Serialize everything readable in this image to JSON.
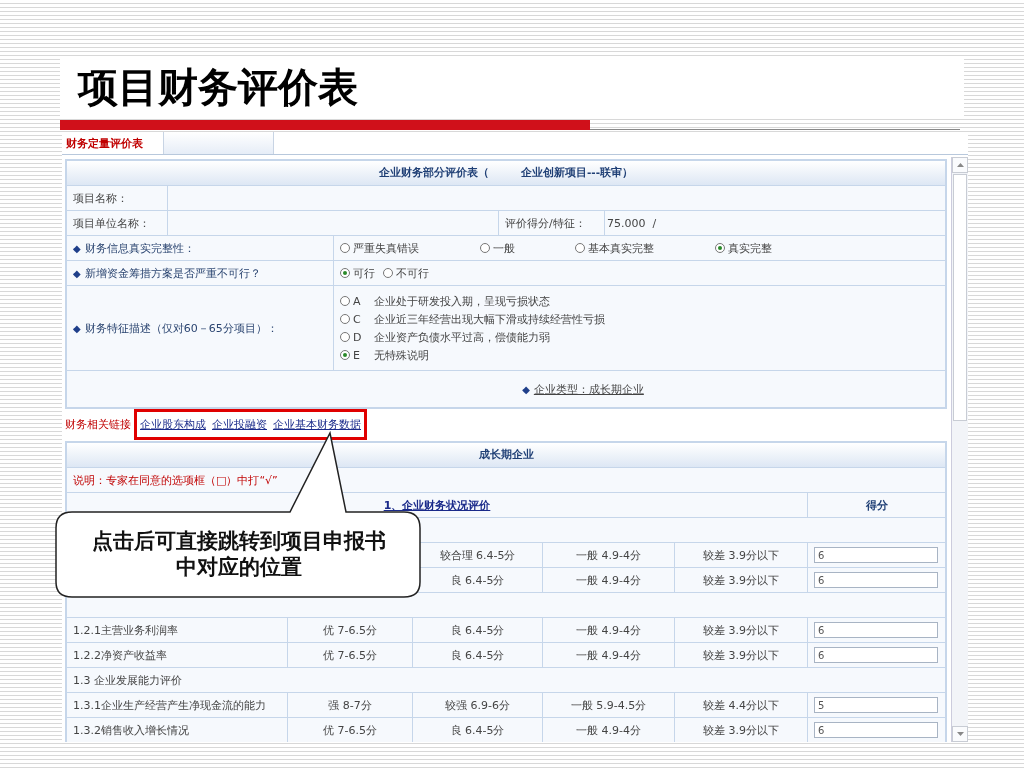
{
  "slide": {
    "title": "项目财务评价表"
  },
  "tabs": [
    {
      "label": "财务定量评价表",
      "selected": true
    },
    {
      "selected": false
    }
  ],
  "form": {
    "heading": [
      "企业财务部分评价表（",
      "企业创新项目---联审）"
    ],
    "project_name_label": "项目名称：",
    "unit_name_label": "项目单位名称：",
    "score_label": "评价得分/特征：",
    "score_value": "75.000  /",
    "questions": [
      {
        "bullet": "◆",
        "label": "财务信息真实完整性：",
        "kind": "inline",
        "options": [
          {
            "label": "严重失真错误",
            "selected": false
          },
          {
            "label": "一般",
            "selected": false
          },
          {
            "label": "基本真实完整",
            "selected": false
          },
          {
            "label": "真实完整",
            "selected": true
          }
        ]
      },
      {
        "bullet": "◆",
        "label": "新增资金筹措方案是否严重不可行？",
        "kind": "compact",
        "options": [
          {
            "label": "可行",
            "selected": true
          },
          {
            "label": "不可行",
            "selected": false
          }
        ]
      },
      {
        "bullet": "◆",
        "label": "财务特征描述（仅对60－65分项目）：",
        "kind": "stacked",
        "options": [
          {
            "letter": "A",
            "label": "企业处于研发投入期，呈现亏损状态",
            "selected": false
          },
          {
            "letter": "C",
            "label": "企业近三年经营出现大幅下滑或持续经营性亏损",
            "selected": false
          },
          {
            "letter": "D",
            "label": "企业资产负债水平过高，偿债能力弱",
            "selected": false
          },
          {
            "letter": "E",
            "label": "无特殊说明",
            "selected": true
          }
        ]
      }
    ],
    "company_type": {
      "bullet": "◆",
      "text": "企业类型：成长期企业"
    }
  },
  "links": {
    "label": "财务相关链接",
    "items": [
      "企业股东构成",
      "企业投融资",
      "企业基本财务数据"
    ]
  },
  "evaluation": {
    "title": "成长期企业",
    "note": "说明：专家在同意的选项框（□）中打“√”",
    "section_title": "1、企业财务状况评价",
    "score_header": "得分",
    "rows": [
      {
        "kind": "section"
      },
      {
        "kind": "item",
        "grades": [
          "较合理 6.4-5分",
          "一般 4.9-4分",
          "较差 3.9分以下"
        ],
        "score": "6"
      },
      {
        "kind": "item",
        "grades": [
          "良 6.4-5分",
          "一般 4.9-4分",
          "较差 3.9分以下"
        ],
        "score": "6"
      },
      {
        "kind": "section"
      },
      {
        "kind": "item",
        "name": "1.2.1主营业务利润率",
        "grades": [
          "优 7-6.5分",
          "良 6.4-5分",
          "一般 4.9-4分",
          "较差 3.9分以下"
        ],
        "score": "6"
      },
      {
        "kind": "item",
        "name": "1.2.2净资产收益率",
        "grades": [
          "优 7-6.5分",
          "良 6.4-5分",
          "一般 4.9-4分",
          "较差 3.9分以下"
        ],
        "score": "6"
      },
      {
        "kind": "section",
        "label": "1.3 企业发展能力评价"
      },
      {
        "kind": "item",
        "name": "1.3.1企业生产经营产生净现金流的能力",
        "grades": [
          "强 8-7分",
          "较强 6.9-6分",
          "一般 5.9-4.5分",
          "较差 4.4分以下"
        ],
        "score": "5"
      },
      {
        "kind": "item",
        "name": "1.3.2销售收入增长情况",
        "grades": [
          "优 7-6.5分",
          "良 6.4-5分",
          "一般 4.9-4分",
          "较差 3.9分以下"
        ],
        "score": "6"
      }
    ]
  },
  "callout": {
    "text": "点击后可直接跳转到项目申报书中对应的位置"
  }
}
